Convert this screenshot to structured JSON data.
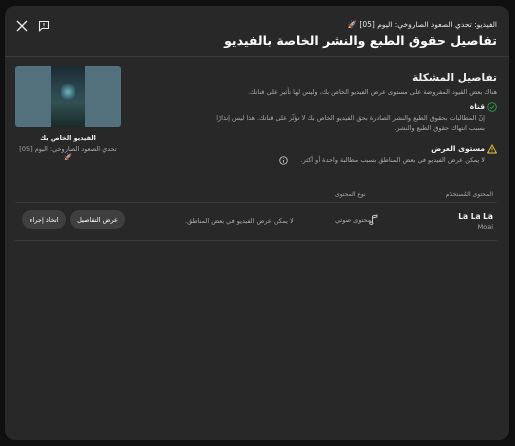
{
  "dialog": {
    "video_line": "الفيديو: تحدي الصعود الصاروخي: اليوم [05] 🚀",
    "title": "تفاصيل حقوق الطبع والنشر الخاصة بالفيديو"
  },
  "thumbnail": {
    "caption_title": "الفيديو الخاص بك",
    "caption_video": "تحدي الصعود الصاروخي: اليوم [05] 🚀"
  },
  "issue": {
    "title": "تفاصيل المشكلة",
    "description": "هناك بعض القيود المفروضة على مستوى عرض الفيديو الخاص بك، وليس لها تأثير على قناتك.",
    "channel": {
      "title": "قناة",
      "line1": "إنّ المطالبات بحقوق الطبع والنشر الصادرة بحق الفيديو الخاص بك لا تؤثّر على قناتك. هذا ليس إنذارًا",
      "line2": "بسبب انتهاك حقوق الطبع والنشر."
    },
    "visibility": {
      "title": "مستوى العرض",
      "line1": "لا يمكن عرض الفيديو في بعض المناطق بسبب مطالبة واحدة أو أكثر."
    }
  },
  "table": {
    "headers": {
      "claimed_content": "المحتوى المُستخدَم",
      "content_type": "نوع المحتوى"
    },
    "row": {
      "song": "La La La",
      "artist": "Moai",
      "content_type": "محتوى صوتي",
      "impact": "لا يمكن عرض الفيديو في بعض المناطق.",
      "details_button": "عرض التفاصيل",
      "action_button": "اتخاذ إجراء"
    }
  },
  "colors": {
    "dialog_bg": "#282828",
    "success": "#2ba640",
    "warning": "#f2c744",
    "pill_bg": "#3f3f3f"
  }
}
